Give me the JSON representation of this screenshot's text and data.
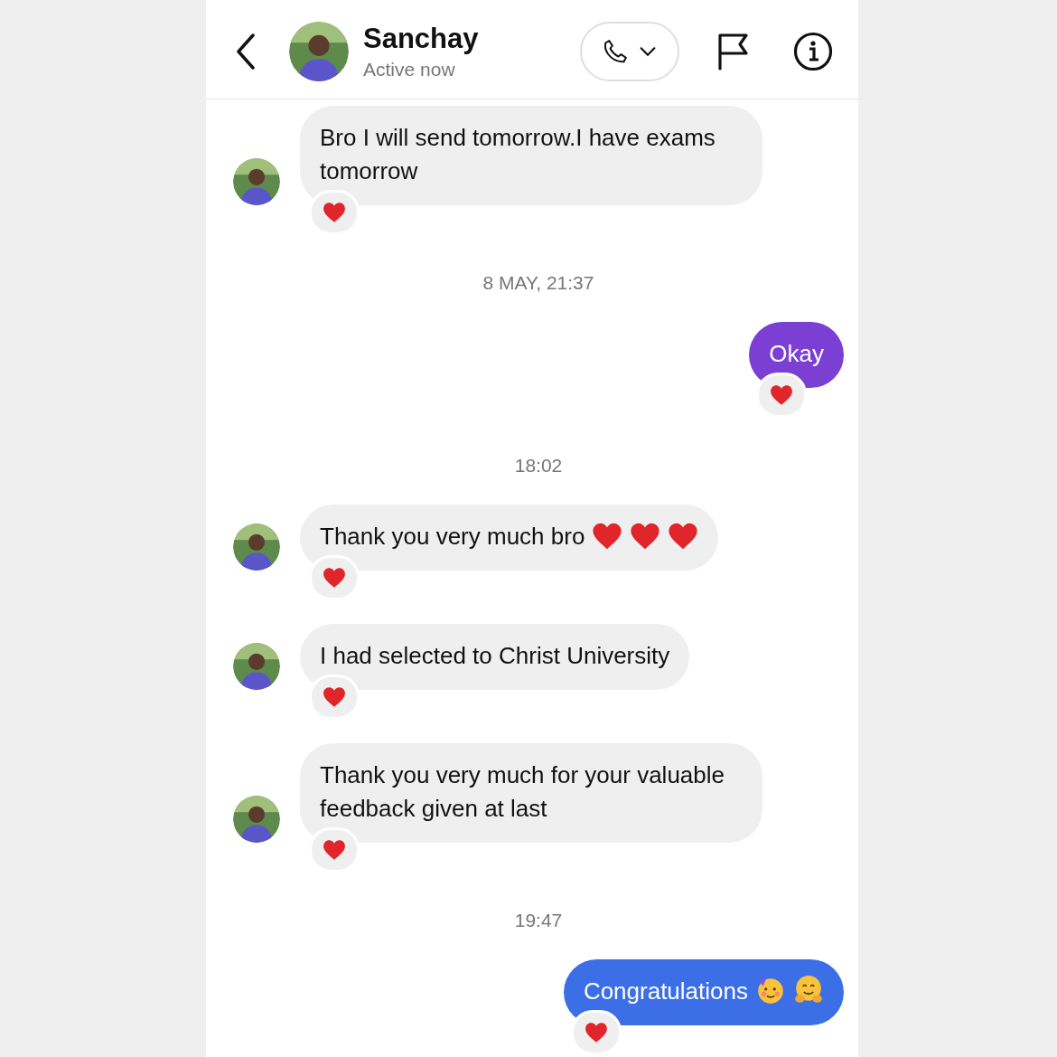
{
  "header": {
    "name": "Sanchay",
    "status": "Active now"
  },
  "messages": [
    {
      "kind": "received",
      "text": "Bro I will send tomorrow.I have exams tomorrow",
      "reacted": true
    },
    {
      "kind": "timestamp",
      "text": "8 MAY, 21:37"
    },
    {
      "kind": "sent",
      "text": "Okay",
      "color": "#7b3fd4",
      "reacted": true
    },
    {
      "kind": "timestamp",
      "text": "18:02"
    },
    {
      "kind": "received",
      "text": "Thank you very much bro",
      "emojis": [
        {
          "kind": "heart"
        },
        {
          "kind": "heart"
        },
        {
          "kind": "heart"
        }
      ],
      "reacted": true
    },
    {
      "kind": "received",
      "text": "I had selected to Christ University",
      "reacted": true
    },
    {
      "kind": "received",
      "text": "Thank you very much for your valuable feedback given at last",
      "reacted": true
    },
    {
      "kind": "timestamp",
      "text": "19:47"
    },
    {
      "kind": "sent",
      "text": "Congratulations",
      "emojis": [
        {
          "kind": "party-face"
        },
        {
          "kind": "hugging-face"
        }
      ],
      "color": "#3c6fe6",
      "reacted": true
    }
  ]
}
